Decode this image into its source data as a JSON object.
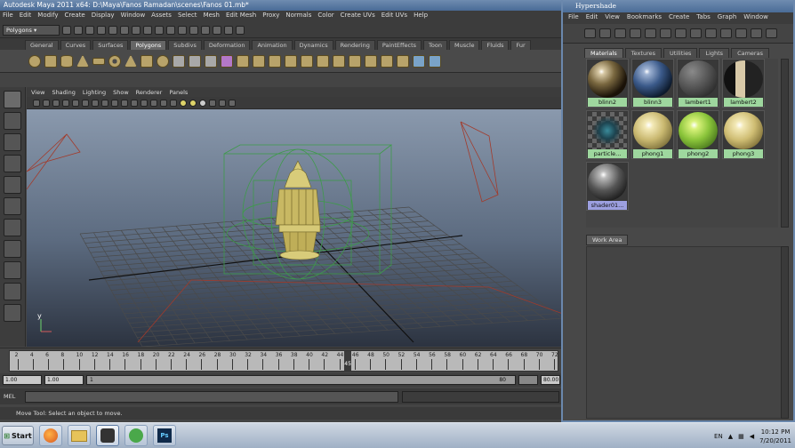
{
  "maya": {
    "title": "Autodesk Maya 2011 x64: D:\\Maya\\Fanos Ramadan\\scenes\\Fanos 01.mb*",
    "menus": [
      "File",
      "Edit",
      "Modify",
      "Create",
      "Display",
      "Window",
      "Assets",
      "Select",
      "Mesh",
      "Edit Mesh",
      "Proxy",
      "Normals",
      "Color",
      "Create UVs",
      "Edit UVs",
      "Help"
    ],
    "mode_selector": "Polygons",
    "shelf_tabs": [
      "General",
      "Curves",
      "Surfaces",
      "Polygons",
      "Subdivs",
      "Deformation",
      "Animation",
      "Dynamics",
      "Rendering",
      "PaintEffects",
      "Toon",
      "Muscle",
      "Fluids",
      "Fur"
    ],
    "active_shelf_tab": "Polygons",
    "panel_menus": [
      "View",
      "Shading",
      "Lighting",
      "Show",
      "Renderer",
      "Panels"
    ],
    "axis_label": "y",
    "timeline": {
      "tick_labels": [
        "2",
        "4",
        "6",
        "8",
        "10",
        "12",
        "14",
        "16",
        "18",
        "20",
        "22",
        "24",
        "26",
        "28",
        "30",
        "32",
        "34",
        "36",
        "38",
        "40",
        "42",
        "44",
        "46",
        "48",
        "50",
        "52",
        "54",
        "56",
        "58",
        "60",
        "62",
        "64",
        "66",
        "68",
        "70",
        "72"
      ],
      "current_frame": "45",
      "start": 1,
      "end": 72,
      "current": 45
    },
    "range": {
      "start_time": "1.00",
      "playback_start": "1.00",
      "range_start_label": "1",
      "range_end_label": "80",
      "end_time": "80.00"
    },
    "command_label": "MEL",
    "help_line": "Move Tool: Select an object to move."
  },
  "hypershade": {
    "title": "Hypershade",
    "menus": [
      "File",
      "Edit",
      "View",
      "Bookmarks",
      "Create",
      "Tabs",
      "Graph",
      "Window"
    ],
    "tabs": [
      "Materials",
      "Textures",
      "Utilities",
      "Lights",
      "Cameras"
    ],
    "active_tab": "Materials",
    "swatches": [
      {
        "name": "blinn2",
        "style": "blinn2"
      },
      {
        "name": "blinn3",
        "style": "blinn3"
      },
      {
        "name": "lambert1",
        "style": "lambert1"
      },
      {
        "name": "lambert2",
        "style": "lambert2"
      },
      {
        "name": "particle...",
        "style": "particle"
      },
      {
        "name": "phong1",
        "style": "phong1"
      },
      {
        "name": "phong2",
        "style": "phong2"
      },
      {
        "name": "phong3",
        "style": "phong3"
      },
      {
        "name": "shader01...",
        "style": "shader01",
        "highlight": "blue"
      }
    ],
    "work_area_label": "Work Area"
  },
  "taskbar": {
    "start_label": "Start",
    "language": "EN",
    "time": "10:12 PM",
    "date": "7/20/2011",
    "app_icons": [
      "firefox-icon",
      "folder-icon",
      "maya-icon",
      "network-icon",
      "photoshop-icon"
    ],
    "photoshop_label": "Ps"
  },
  "colors": {
    "title_blue": "#496b96",
    "swatch_label_green": "#9ed79e",
    "swatch_label_blue": "#9c9fe0",
    "wireframe_green": "#3e9a4a",
    "model_gold": "#c8b863"
  }
}
